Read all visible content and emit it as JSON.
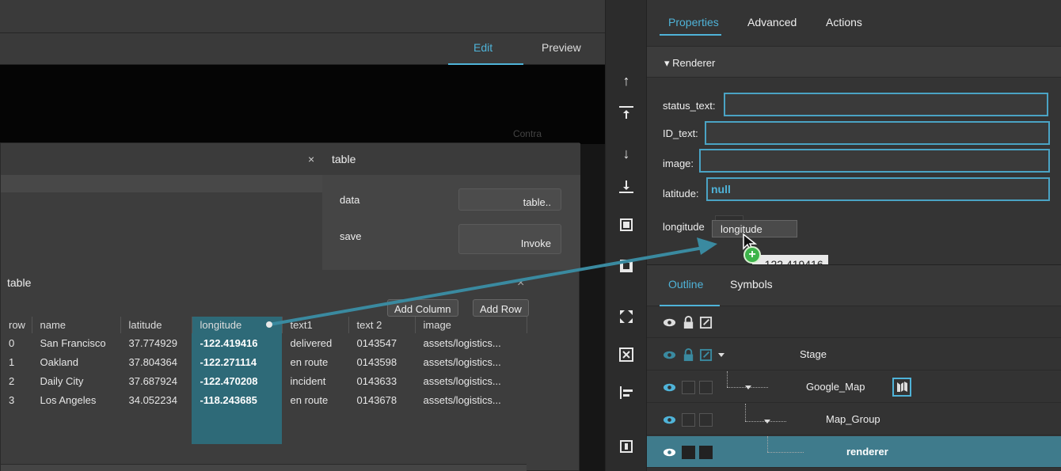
{
  "editor": {
    "modes": [
      "Edit",
      "Preview"
    ],
    "stage_ghost_text": "Contra"
  },
  "table_panel": {
    "close_glyph": "×",
    "title": "table",
    "properties": [
      {
        "label": "data",
        "button": "table.."
      },
      {
        "label": "save",
        "button": "Invoke"
      }
    ]
  },
  "grid": {
    "title": "table",
    "close_glyph": "×",
    "add_column": "Add Column",
    "add_row": "Add Row",
    "columns": [
      "row",
      "name",
      "latitude",
      "longitude",
      "text1",
      "text 2",
      "image"
    ],
    "selected_column": "longitude",
    "rows": [
      [
        "0",
        "San Francisco",
        "37.774929",
        "-122.419416",
        "delivered",
        "0143547",
        "assets/logistics..."
      ],
      [
        "1",
        "Oakland",
        "37.804364",
        "-122.271114",
        "en route",
        "0143598",
        "assets/logistics..."
      ],
      [
        "2",
        "Daily City",
        "37.687924",
        "-122.470208",
        "incident",
        "0143633",
        "assets/logistics..."
      ],
      [
        "3",
        "Los Angeles",
        "34.052234",
        "-118.243685",
        "en route",
        "0143678",
        "assets/logistics..."
      ]
    ]
  },
  "tools": [
    "arrow-up-icon",
    "bring-to-front-icon",
    "arrow-down-icon",
    "send-to-back-icon",
    "fit-frame-icon",
    "scale-frame-icon",
    "expand-icon",
    "close-box-icon",
    "align-left-icon",
    "panel-icon"
  ],
  "right_panel": {
    "tabs": [
      "Properties",
      "Advanced",
      "Actions"
    ],
    "section": "▾ Renderer",
    "fields": [
      {
        "label": "status_text:",
        "value": ""
      },
      {
        "label": "ID_text:",
        "value": ""
      },
      {
        "label": "image:",
        "value": ""
      },
      {
        "label": "latitude:",
        "value": "null"
      },
      {
        "label": "longitude",
        "value": ""
      }
    ],
    "drag_label": "longitude",
    "drag_tooltip": "-122.419416",
    "plus_glyph": "+"
  },
  "outline": {
    "tabs": [
      "Outline",
      "Symbols"
    ],
    "nodes": [
      "Stage",
      "Google_Map",
      "Map_Group",
      "renderer"
    ]
  },
  "colors": {
    "accent": "#4fb3d8",
    "selection": "#3f7b8c",
    "drag_arrow": "#3a8aa0",
    "add_badge": "#3cb44a"
  }
}
